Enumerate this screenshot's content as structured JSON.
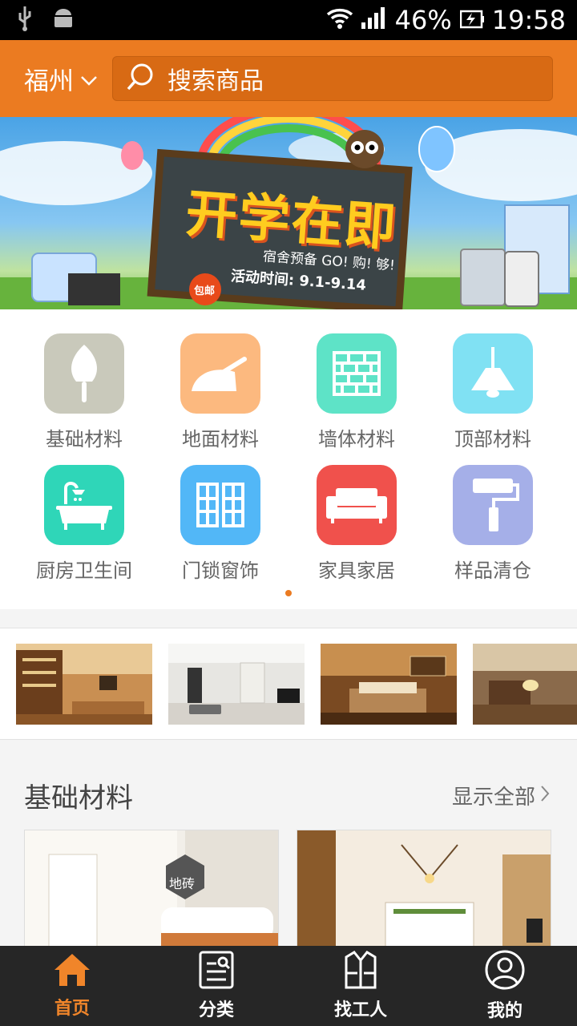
{
  "status_bar": {
    "battery_percent": "46%",
    "time": "19:58"
  },
  "header": {
    "city": "福州",
    "search_placeholder": "搜索商品"
  },
  "banner": {
    "headline": "开学在即",
    "slogan": "宿舍预备 GO! 购! 够!",
    "badge": "包邮",
    "activity": "活动时间: 9.1-9.14"
  },
  "categories": [
    {
      "label": "基础材料",
      "icon": "trowel-icon",
      "color": "#c9c9bb"
    },
    {
      "label": "地面材料",
      "icon": "plastering-trowel-icon",
      "color": "#fcb97f"
    },
    {
      "label": "墙体材料",
      "icon": "brick-wall-icon",
      "color": "#5ee3c7"
    },
    {
      "label": "顶部材料",
      "icon": "ceiling-lamp-icon",
      "color": "#80e1f3"
    },
    {
      "label": "厨房卫生间",
      "icon": "bathtub-icon",
      "color": "#2fd6b8"
    },
    {
      "label": "门锁窗饰",
      "icon": "window-icon",
      "color": "#52b7f7"
    },
    {
      "label": "家具家居",
      "icon": "sofa-icon",
      "color": "#f0514c"
    },
    {
      "label": "样品清仓",
      "icon": "paint-roller-icon",
      "color": "#a5afe8"
    }
  ],
  "section": {
    "title": "基础材料",
    "more_label": "显示全部",
    "card_tag": "地砖"
  },
  "bottom_nav": [
    {
      "label": "首页",
      "icon": "home-icon",
      "active": true
    },
    {
      "label": "分类",
      "icon": "category-list-icon",
      "active": false
    },
    {
      "label": "找工人",
      "icon": "worker-vest-icon",
      "active": false
    },
    {
      "label": "我的",
      "icon": "user-profile-icon",
      "active": false
    }
  ],
  "colors": {
    "brand": "#eb7b21",
    "nav_background": "#262626",
    "active_nav": "#f0852a"
  }
}
